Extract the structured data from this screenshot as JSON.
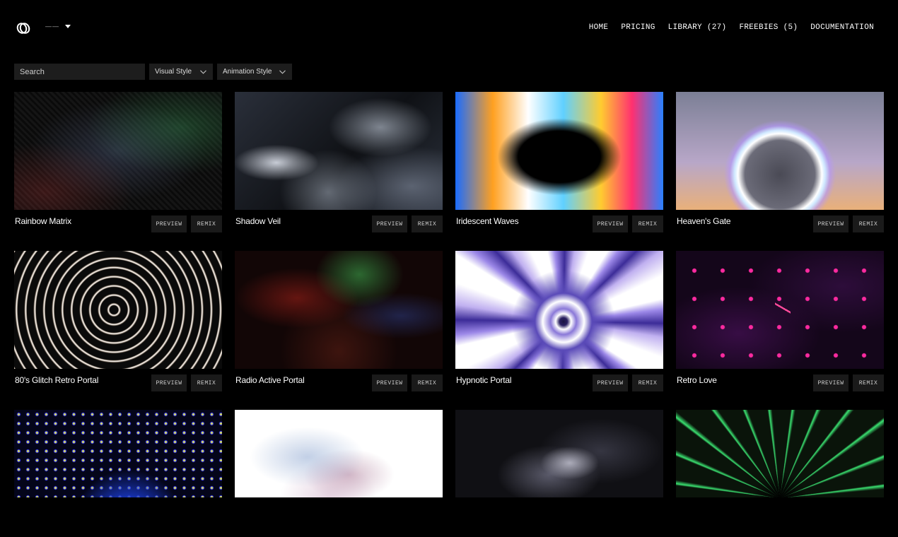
{
  "header": {
    "logo_icon": "interlocking-rings-icon",
    "language_label": "——",
    "nav": [
      "HOME",
      "PRICING",
      "LIBRARY (27)",
      "FREEBIES (5)",
      "DOCUMENTATION"
    ]
  },
  "filters": {
    "search_placeholder": "Search",
    "visual_style": "Visual Style",
    "animation_style": "Animation Style"
  },
  "buttons": {
    "preview": "PREVIEW",
    "remix": "REMIX"
  },
  "cards": [
    {
      "title": "Rainbow Matrix"
    },
    {
      "title": "Shadow Veil"
    },
    {
      "title": "Iridescent Waves"
    },
    {
      "title": "Heaven's Gate"
    },
    {
      "title": "80's Glitch Retro Portal"
    },
    {
      "title": "Radio Active Portal"
    },
    {
      "title": "Hypnotic Portal"
    },
    {
      "title": "Retro Love"
    },
    {
      "title": ""
    },
    {
      "title": ""
    },
    {
      "title": ""
    },
    {
      "title": ""
    }
  ],
  "colors": {
    "background": "#000000",
    "button_bg": "#1a1a1a",
    "input_bg": "#1d1d1d"
  }
}
